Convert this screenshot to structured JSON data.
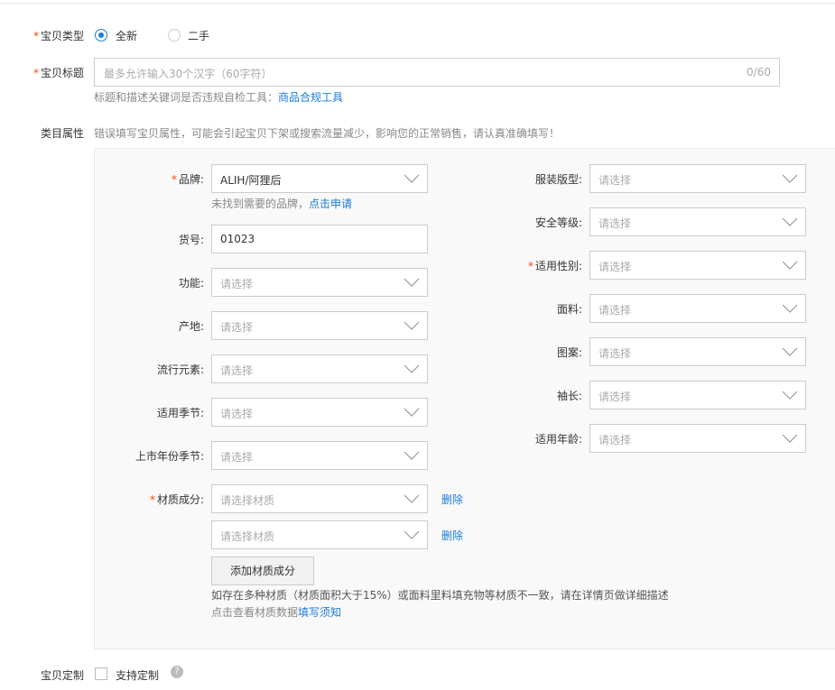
{
  "item_type": {
    "label": "宝贝类型",
    "options": [
      {
        "label": "全新",
        "selected": true
      },
      {
        "label": "二手",
        "selected": false
      }
    ]
  },
  "item_title": {
    "label": "宝贝标题",
    "placeholder": "最多允许输入30个汉字（60字符）",
    "counter": "0/60",
    "hint_prefix": "标题和描述关键词是否违规自检工具：",
    "hint_link": "商品合规工具"
  },
  "category": {
    "label": "类目属性",
    "warning": "错误填写宝贝属性，可能会引起宝贝下架或搜索流量减少，影响您的正常销售，请认真准确填写！"
  },
  "left_fields": {
    "brand": {
      "label": "品牌:",
      "value": "ALIH/阿狸后",
      "required": true
    },
    "brand_hint_prefix": "未找到需要的品牌，",
    "brand_hint_link": "点击申请",
    "item_no": {
      "label": "货号:",
      "value": "01023"
    },
    "function": {
      "label": "功能:",
      "placeholder": "请选择"
    },
    "origin": {
      "label": "产地:",
      "placeholder": "请选择"
    },
    "trend": {
      "label": "流行元素:",
      "placeholder": "请选择"
    },
    "season": {
      "label": "适用季节:",
      "placeholder": "请选择"
    },
    "launch_season": {
      "label": "上市年份季节:",
      "placeholder": "请选择"
    },
    "material": {
      "label": "材质成分:",
      "required": true,
      "placeholder": "请选择材质",
      "delete": "删除"
    },
    "material2": {
      "placeholder": "请选择材质",
      "delete": "删除"
    },
    "add_material": "添加材质成分",
    "material_note": "如存在多种材质（材质面积大于15%）或面料里料填充物等材质不一致，请在详情页做详细描述",
    "material_link_prefix": "点击查看材质数据",
    "material_link": "填写须知"
  },
  "right_fields": {
    "fit": {
      "label": "服装版型:",
      "placeholder": "请选择"
    },
    "safety": {
      "label": "安全等级:",
      "placeholder": "请选择"
    },
    "gender": {
      "label": "适用性别:",
      "placeholder": "请选择",
      "required": true
    },
    "fabric": {
      "label": "面料:",
      "placeholder": "请选择"
    },
    "pattern": {
      "label": "图案:",
      "placeholder": "请选择"
    },
    "sleeve": {
      "label": "袖长:",
      "placeholder": "请选择"
    },
    "age": {
      "label": "适用年龄:",
      "placeholder": "请选择"
    }
  },
  "customize": {
    "label": "宝贝定制",
    "checkbox_label": "支持定制",
    "help": "?"
  }
}
